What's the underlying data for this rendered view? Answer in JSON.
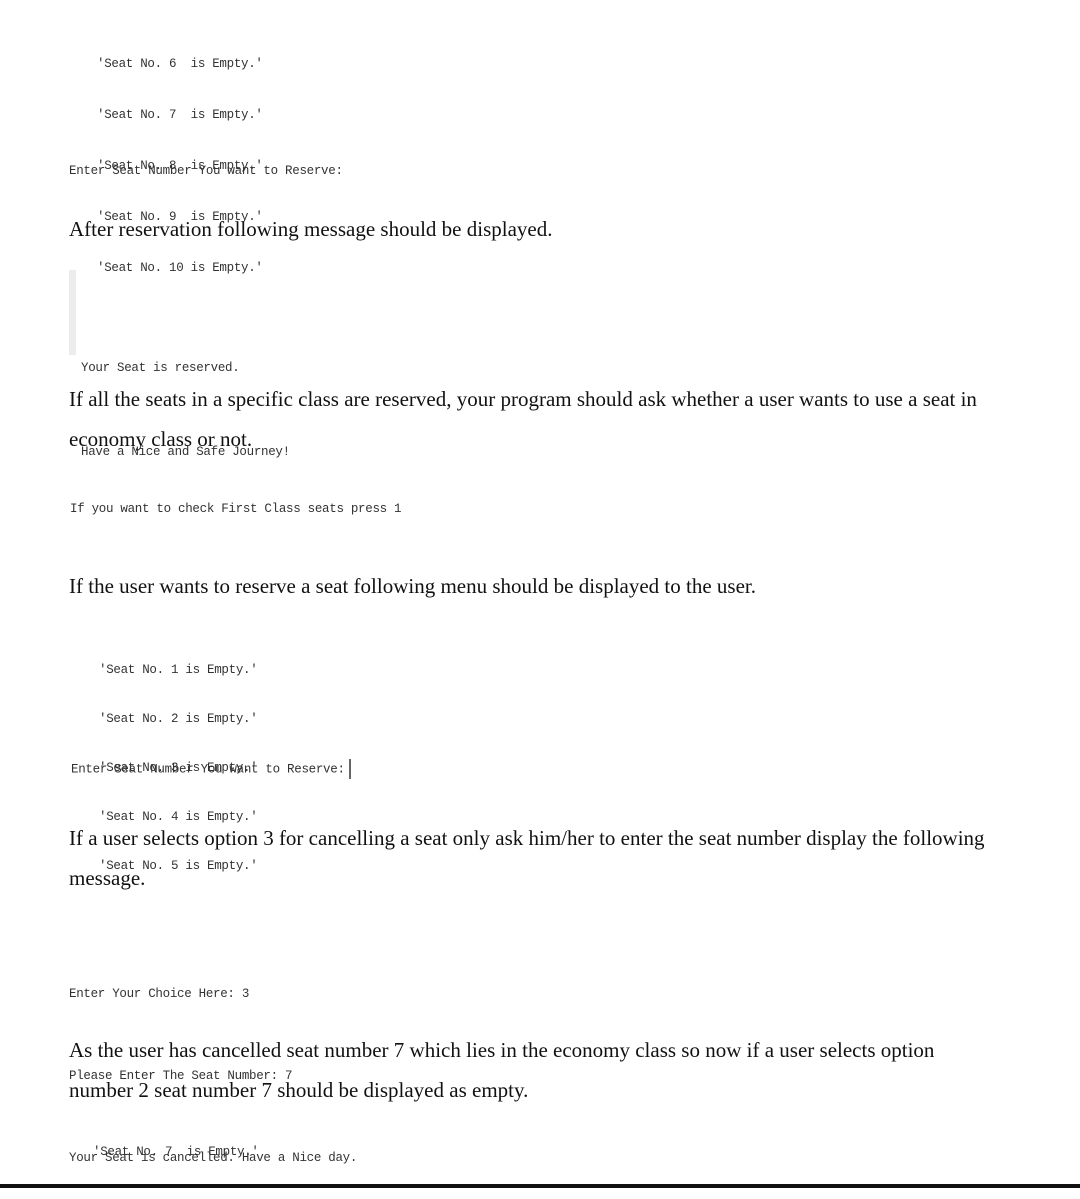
{
  "section1": {
    "seat_lines": [
      "'Seat No. 6  is Empty.'",
      "'Seat No. 7  is Empty.'",
      "'Seat No. 8  is Empty.'",
      "'Seat No. 9  is Empty.'",
      "'Seat No. 10 is Empty.'"
    ],
    "prompt": "Enter Seat Number You want to Reserve:"
  },
  "para_after_reservation": "After reservation following message should be displayed.",
  "reserved_message": {
    "line1": "Your Seat is reserved.",
    "line2": "Have a Nice and Safe Journey!"
  },
  "para_all_reserved": "If all the seats in a specific class are reserved, your program should ask whether a user wants to use a seat in economy class or not.",
  "first_class_prompt": "If you want to check First Class seats press 1",
  "para_reserve_menu": "If the user wants to reserve a seat following menu should be displayed to the user.",
  "section2": {
    "seat_lines": [
      "'Seat No. 1 is Empty.'",
      "'Seat No. 2 is Empty.'",
      "'Seat No. 3 is Empty.'",
      "'Seat No. 4 is Empty.'",
      "'Seat No. 5 is Empty.'"
    ],
    "prompt": "Enter Seat Number You want to Reserve:"
  },
  "para_cancel": "If a user selects option 3 for cancelling a seat only ask him/her to enter the seat number display the following message.",
  "cancel_console": {
    "line1": "Enter Your Choice Here: 3",
    "line2": "Please Enter The Seat Number: 7",
    "line3": "Your Seat is cancelled. Have a Nice day."
  },
  "para_after_cancel": "As the user has cancelled seat number 7 which lies in the economy class so now if a user selects option number 2 seat number 7 should be displayed as empty.",
  "final_seat_line": "'Seat No. 7  is Empty.'"
}
